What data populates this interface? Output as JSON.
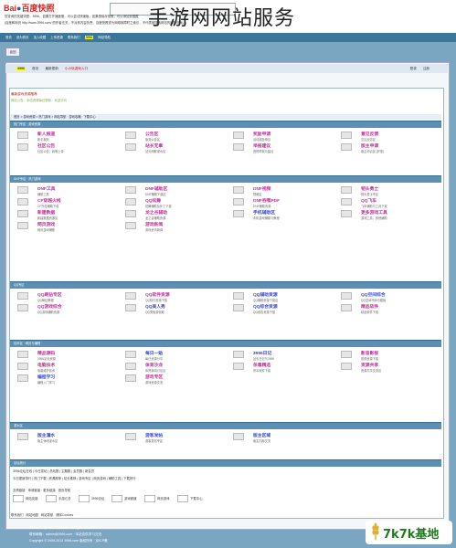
{
  "overlay_title": "手游网网站服务",
  "cache": {
    "logo": "百度快照",
    "line1": "您查询的关键词是：3996，如果打开速度慢，可以尝试快速版；如果想保存快照，可以添加到搜藏",
    "line2": "(百度和网页 http://www.3996.com/ 的作者无关，不对其内容负责。百度快照谨为网络故障时之索引，不代表被搜索网站的即时页面。)"
  },
  "strip": [
    "首页",
    "设为首页",
    "加入收藏",
    "上传资源",
    "联系我们",
    "3996",
    "网站导航"
  ],
  "nav_button": "返回",
  "topbar": {
    "logo": "3996",
    "items": [
      "首页",
      "最新更新",
      "小小玩游戏入口"
    ],
    "right": [
      "登录",
      "注册"
    ]
  },
  "notice": "最新游戏资源推荐",
  "notice2": "网站公告：本站资源每日更新，欢迎访问",
  "crumb1": "首页 > 游戏资源 > 热门游戏 > 网站导航 · 游戏攻略 · 下载中心",
  "sections": [
    {
      "bar": "热门专区 · 游戏资源",
      "rows": [
        [
          {
            "t": "新人报道",
            "s": "新手报到",
            "c": "m"
          },
          {
            "t": "公告区",
            "s": "版务公告区",
            "c": "m"
          },
          {
            "t": "奖励申请",
            "s": "活动奖励申请",
            "c": "m"
          },
          {
            "t": "意见反馈",
            "s": "意见反馈区",
            "c": "m"
          }
        ],
        [
          {
            "t": "社区公告",
            "s": "社区公告，着等上帝",
            "c": "m"
          },
          {
            "t": "站长无事",
            "s": "站长闲聊灌水区",
            "c": "m"
          },
          {
            "t": "举报建议",
            "s": "违规举报与建议",
            "c": "m"
          },
          {
            "t": "版主申请",
            "s": "版主申请区 [开放]",
            "c": "m"
          }
        ]
      ]
    },
    {
      "bar": "DNF专区 · 热门游戏",
      "rows": [
        [
          {
            "t": "DNF工具",
            "s": "辅助工具",
            "c": "m"
          },
          {
            "t": "DNF辅助区",
            "s": "DNF辅助下载区",
            "c": "m"
          },
          {
            "t": "DNF视频",
            "s": "视频区",
            "c": "m"
          },
          {
            "t": "韧头勇士",
            "s": "韧头勇士专区",
            "c": "m"
          }
        ],
        [
          {
            "t": "CF穿越火线",
            "s": "CF外挂辅助下载",
            "c": "m"
          },
          {
            "t": "QQ炫舞",
            "s": "炫舞辅助及补丁下载",
            "c": "m"
          },
          {
            "t": "DNF吞噬PDF",
            "s": "DNF辅助资源",
            "c": "m"
          },
          {
            "t": "QQ飞车",
            "s": "飞车辅助与工具下载",
            "c": "m"
          }
        ],
        [
          {
            "t": "新建数据",
            "s": "新建数据资源区",
            "c": "m"
          },
          {
            "t": "龙之谷辅助",
            "s": "龙之谷辅助资源",
            "c": "m"
          },
          {
            "t": "手机辅助区",
            "s": "手机游戏辅助与教程",
            "c": "b"
          },
          {
            "t": "更多游戏工具",
            "s": "游戏工具，其他辅助",
            "c": "m"
          }
        ],
        [
          {
            "t": "网页游戏",
            "s": "网页游戏辅助",
            "c": "m"
          },
          {
            "t": "游戏新闻",
            "s": "游戏资讯新闻",
            "c": "m"
          }
        ]
      ]
    },
    {
      "bar": "QQ专区",
      "rows": [
        [
          {
            "t": "QQ刷钻专区",
            "s": "QQ刷钻教程",
            "c": "m"
          },
          {
            "t": "QQ软件资源",
            "s": "QQ软件资源下载",
            "c": "m"
          },
          {
            "t": "QQ辅助资源",
            "s": "QQ辅助资源下载区",
            "c": "b"
          },
          {
            "t": "QQ空间综合",
            "s": "QQ空间代码与模板",
            "c": "b"
          }
        ],
        [
          {
            "t": "QQ游戏综合",
            "s": "QQ游戏辅助资源",
            "c": "m"
          },
          {
            "t": "QQ美人秀",
            "s": "QQ秀免费领取",
            "c": "b"
          },
          {
            "t": "QQ综合资源",
            "s": "QQ综合资源下载",
            "c": "b"
          },
          {
            "t": "精品软件",
            "s": "精品软件下载",
            "c": "m"
          }
        ]
      ]
    },
    {
      "bar": "技术区 · 网页与编程",
      "rows": [
        [
          {
            "t": "精品源码",
            "s": "3996站长资源",
            "c": "m"
          },
          {
            "t": "每日一贴",
            "s": "每日资源分享",
            "c": "b"
          },
          {
            "t": "3996日记",
            "s": "站长日记与3996",
            "c": "b"
          },
          {
            "t": "影音影视",
            "s": "影视资源下载",
            "c": "m"
          }
        ],
        [
          {
            "t": "电脑技术",
            "s": "电脑维护技术",
            "c": "m"
          },
          {
            "t": "体育沙龙",
            "s": "体育新闻讨论区",
            "c": "m"
          },
          {
            "t": "杀毒精选",
            "s": "杀毒软件下载",
            "c": "m"
          },
          {
            "t": "资源共享",
            "s": "资源共享交流区",
            "c": "m"
          }
        ],
        [
          {
            "t": "编程学习",
            "s": "编程入门学习",
            "c": "b"
          },
          {
            "t": "游戏专区",
            "s": "游戏资源交流",
            "c": "m"
          }
        ]
      ]
    },
    {
      "bar": "灌水区",
      "rows": [
        [
          {
            "t": "版主灌水",
            "s": "版主休闲灌水区",
            "c": "b"
          },
          {
            "t": "游客发帖",
            "s": "游客发帖专区",
            "c": "b"
          },
          {
            "t": "版主区域",
            "s": "版主内部交流",
            "c": "b"
          }
        ]
      ]
    }
  ],
  "stats": {
    "bar": "论坛统计",
    "line1": "3996论坛在线 | 今日发帖 | 总帖数 | 主题数 | 会员数 | 新会员",
    "line2": "今日更新排行 | 热门下载 | 资源推荐 | 站长推荐 | 游戏专区 | 网页游戏 | 辅助工具 | 下载排行",
    "line3": "友情链接 · 申请链接 · 更多链接 · 首页导航",
    "links": [
      "网站友链",
      "手游汇总",
      "3996论坛",
      "游戏频道",
      "网页游戏",
      "下载中心"
    ]
  },
  "footer": {
    "row": [
      "联系我们",
      "网站地图",
      "网站导航",
      "清除Cookies"
    ],
    "info1": "Powered by 3996 Network · All rights reserved",
    "info2": "联系邮箱：admin@3996.com · 本站仅供学习交流",
    "info3": "Copyright © 2009-2012 3996.com 版权所有 · 京ICP备"
  },
  "watermark": "7k7k基地"
}
